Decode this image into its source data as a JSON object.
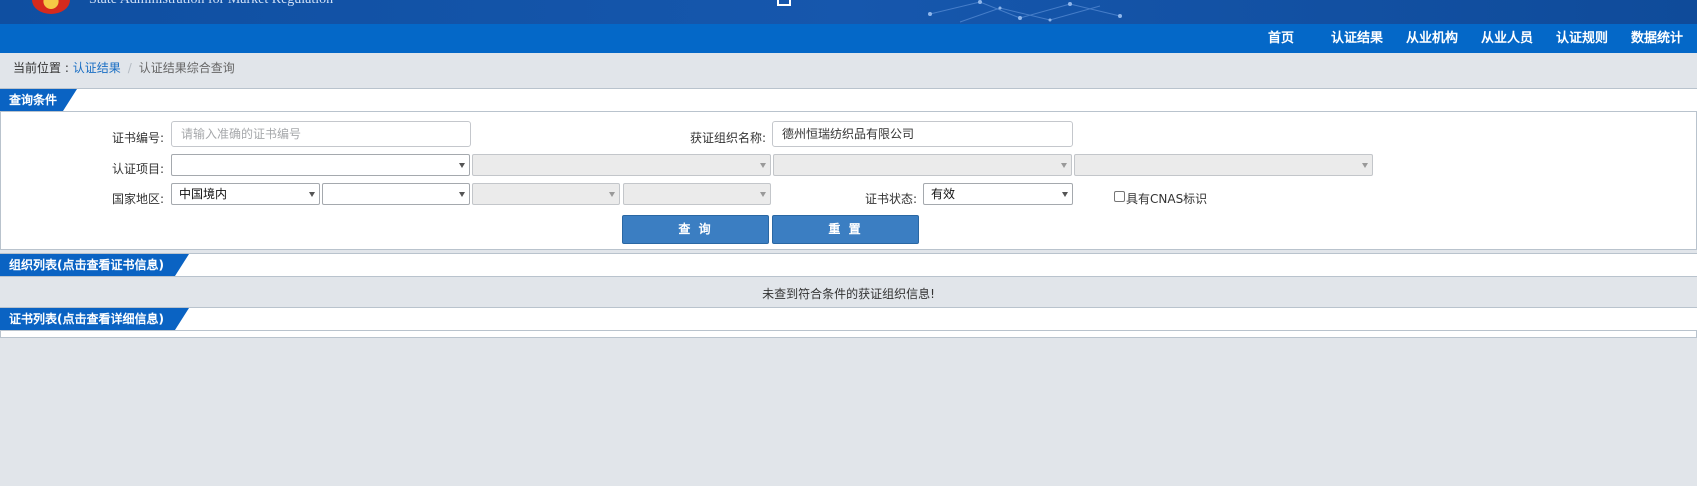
{
  "header": {
    "title_en": "State Administration for Market Regulation"
  },
  "nav": {
    "items": [
      "首页",
      "认证结果",
      "从业机构",
      "从业人员",
      "认证规则",
      "数据统计"
    ]
  },
  "breadcrumb": {
    "prefix": "当前位置 : ",
    "link": "认证结果",
    "separator": "/",
    "current": "认证结果综合查询"
  },
  "query": {
    "section_title": "查询条件",
    "cert_no_label": "证书编号:",
    "cert_no_placeholder": "请输入准确的证书编号",
    "org_name_label": "获证组织名称:",
    "org_name_value": "德州恒瑞纺织品有限公司",
    "project_label": "认证项目:",
    "region_label": "国家地区:",
    "region_value": "中国境内",
    "status_label": "证书状态:",
    "status_value": "有效",
    "cnas_label": "具有CNAS标识",
    "search_button": "查 询",
    "reset_button": "重 置"
  },
  "org_list": {
    "section_title": "组织列表(点击查看证书信息)",
    "empty_message": "未查到符合条件的获证组织信息!"
  },
  "cert_list": {
    "section_title": "证书列表(点击查看详细信息)"
  },
  "colors": {
    "banner": "#0f4fa1",
    "nav": "#0468c8",
    "section_tab": "#0a63c3",
    "button": "#3b7ec2",
    "page_bg": "#e1e5ea"
  }
}
